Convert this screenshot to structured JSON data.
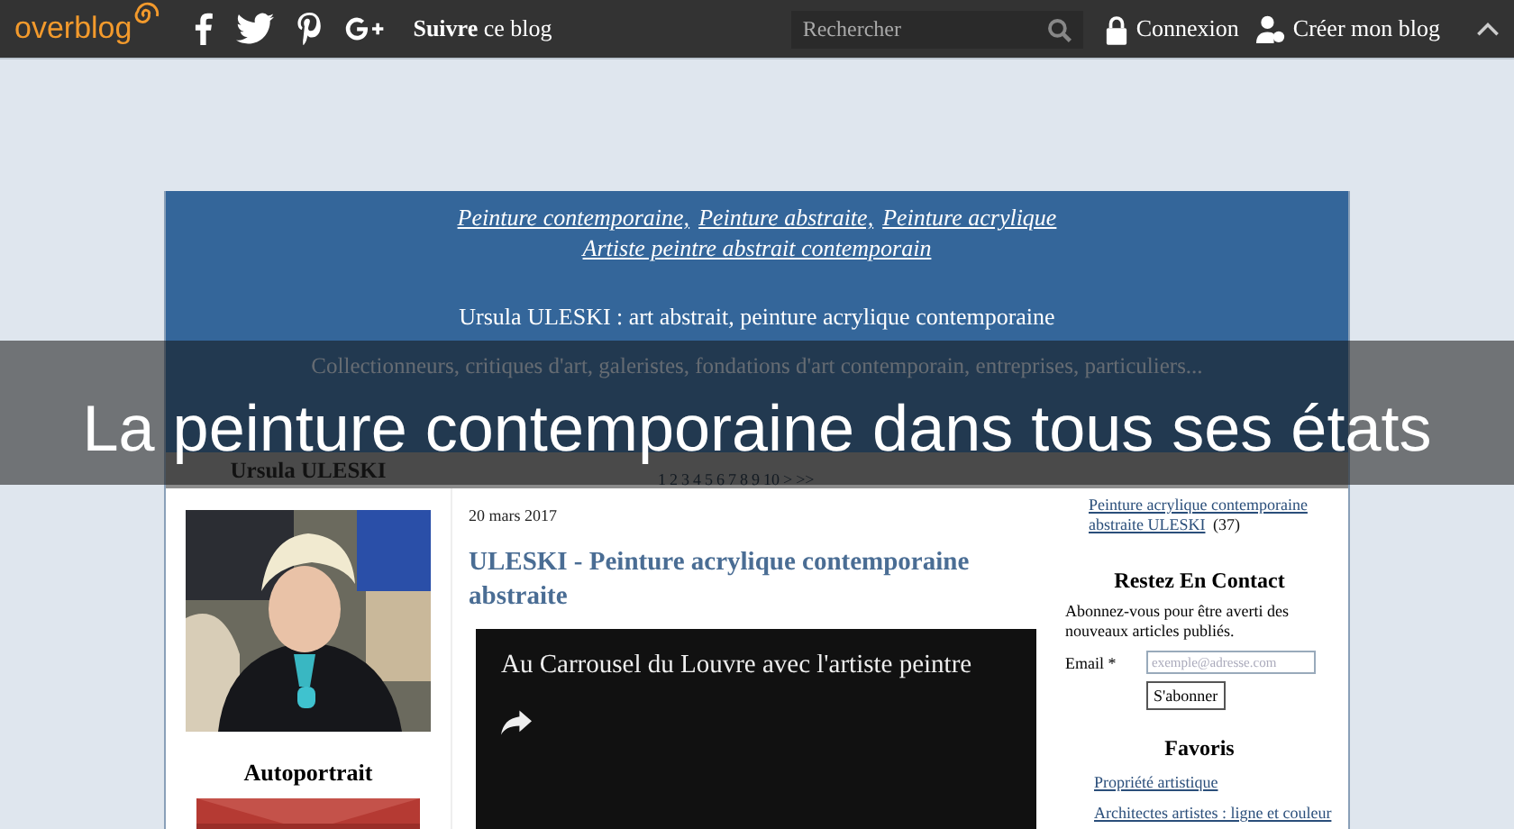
{
  "top_bar": {
    "logo": "overblog",
    "follow": "**Suivre** ce blog",
    "search": {
      "placeholder": "Rechercher"
    },
    "login": "Connexion",
    "create": "Créer mon blog"
  },
  "header": {
    "links": [
      "Peinture contemporaine,",
      "Peinture abstraite,",
      "Peinture acrylique",
      "Artiste peintre abstrait contemporain"
    ],
    "tagline": "Ursula ULESKI : art abstrait, peinture acrylique contemporaine",
    "intro": "Collectionneurs, critiques d'art, galeristes, fondations d'art contemporain, entreprises, particuliers..."
  },
  "banner_title": "La peinture contemporaine dans tous ses états",
  "profile": {
    "name": "Ursula ULESKI",
    "caption": "Autoportrait"
  },
  "pagination": [
    "1",
    "2",
    "3",
    "4",
    "5",
    "6",
    "7",
    "8",
    "9",
    "10",
    ">",
    ">>"
  ],
  "post": {
    "date": "20 mars 2017",
    "title": "ULESKI - Peinture acrylique contemporaine abstraite",
    "video_title": "Au Carrousel du Louvre avec l'artiste peintre"
  },
  "sidebar": {
    "category": {
      "label": "Peinture acrylique contemporaine abstraite ULESKI",
      "count": "(37)"
    },
    "contact": {
      "title": "Restez En Contact",
      "text": "Abonnez-vous pour être averti des nouveaux articles publiés.",
      "email_label": "Email *",
      "email_placeholder": "exemple@adresse.com",
      "button": "S'abonner"
    },
    "favorites": {
      "title": "Favoris",
      "links": [
        "Propriété artistique",
        "Architectes artistes : ligne et couleur"
      ]
    }
  }
}
